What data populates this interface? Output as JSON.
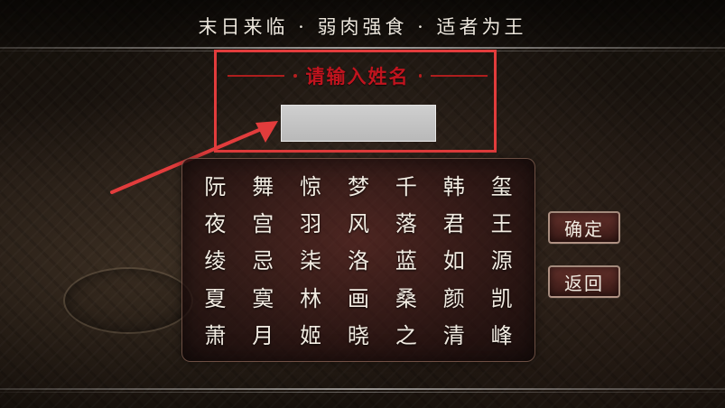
{
  "header": {
    "tagline": "末日来临 · 弱肉强食 · 适者为王"
  },
  "name_prompt": {
    "title": "请输入姓名",
    "input_value": "",
    "input_placeholder": ""
  },
  "character_grid": {
    "rows": [
      [
        "阮",
        "舞",
        "惊",
        "梦",
        "千",
        "韩",
        "玺"
      ],
      [
        "夜",
        "宫",
        "羽",
        "风",
        "落",
        "君",
        "王"
      ],
      [
        "绫",
        "忌",
        "柒",
        "洛",
        "蓝",
        "如",
        "源"
      ],
      [
        "夏",
        "寞",
        "林",
        "画",
        "桑",
        "颜",
        "凯"
      ],
      [
        "萧",
        "月",
        "姬",
        "晓",
        "之",
        "清",
        "峰"
      ]
    ]
  },
  "buttons": {
    "confirm_label": "确定",
    "back_label": "返回"
  },
  "annotations": {
    "highlight_color": "#e23c3c",
    "arrow_color": "#e23c3c",
    "arrow_icon": "arrow-pointer-icon"
  }
}
